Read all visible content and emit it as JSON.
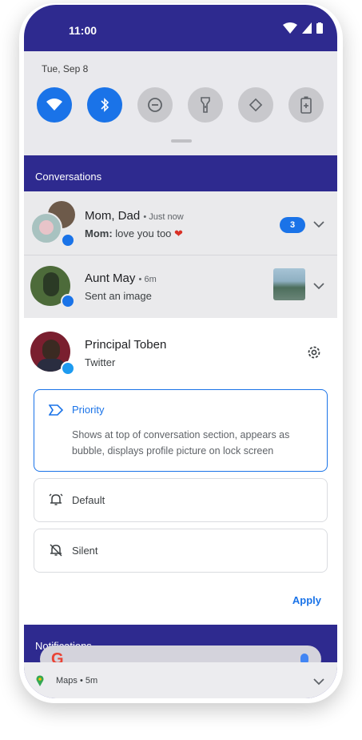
{
  "status_bar": {
    "time": "11:00"
  },
  "quick_settings": {
    "date": "Tue, Sep 8",
    "tiles": [
      {
        "name": "wifi",
        "active": true
      },
      {
        "name": "bluetooth",
        "active": true
      },
      {
        "name": "do-not-disturb",
        "active": false
      },
      {
        "name": "flashlight",
        "active": false
      },
      {
        "name": "auto-rotate",
        "active": false
      },
      {
        "name": "battery-saver",
        "active": false
      }
    ]
  },
  "conversations": {
    "label": "Conversations",
    "items": [
      {
        "name": "Mom, Dad",
        "time": "Just now",
        "sender": "Mom:",
        "message": "love you too",
        "badge": "3",
        "app_icon": "messages-icon"
      },
      {
        "name": "Aunt May",
        "time": "6m",
        "message": "Sent an image",
        "app_icon": "messenger-icon"
      }
    ],
    "expanded": {
      "name": "Principal Toben",
      "app": "Twitter",
      "options": [
        {
          "title": "Priority",
          "description": "Shows at top of conversation section, appears as bubble, displays profile picture on lock screen",
          "icon": "priority-icon",
          "selected": true
        },
        {
          "title": "Default",
          "icon": "bell-icon",
          "selected": false
        },
        {
          "title": "Silent",
          "icon": "bell-off-icon",
          "selected": false
        }
      ],
      "apply_label": "Apply"
    }
  },
  "notifications": {
    "label": "Notifications",
    "maps": {
      "app": "Maps",
      "time": "5m"
    }
  },
  "colors": {
    "accent": "#1a73e8",
    "header": "#2e2a8f"
  }
}
